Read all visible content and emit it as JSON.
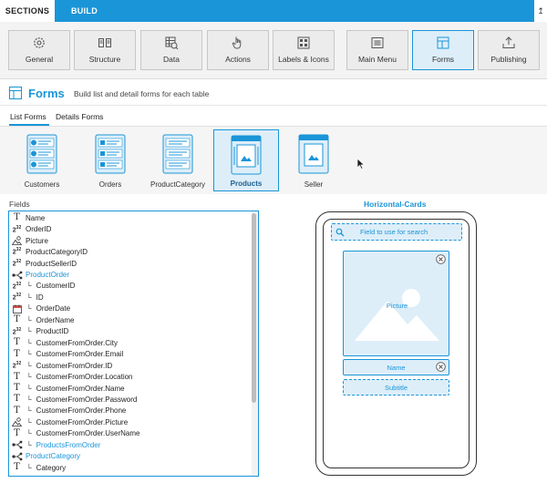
{
  "topbar": {
    "sections_tab": "SECTIONS",
    "build_tab": "BUILD",
    "right_glyph": "↥"
  },
  "section_tiles": [
    {
      "label": "General",
      "icon": "gear-icon"
    },
    {
      "label": "Structure",
      "icon": "structure-icon"
    },
    {
      "label": "Data",
      "icon": "data-icon"
    },
    {
      "label": "Actions",
      "icon": "hand-pointer-icon"
    },
    {
      "label": "Labels & Icons",
      "icon": "labels-icons-icon"
    },
    {
      "label": "Main Menu",
      "icon": "menu-icon"
    },
    {
      "label": "Forms",
      "icon": "forms-icon",
      "active": true
    },
    {
      "label": "Publishing",
      "icon": "publish-icon"
    }
  ],
  "header": {
    "title": "Forms",
    "description": "Build list and detail forms for each table"
  },
  "subtabs": {
    "list_forms": "List Forms",
    "details_forms": "Details Forms",
    "active": "List Forms"
  },
  "tables": [
    {
      "label": "Customers",
      "icon": "list-form-circles-icon"
    },
    {
      "label": "Orders",
      "icon": "list-form-rows-icon"
    },
    {
      "label": "ProductCategory",
      "icon": "list-form-lines-icon"
    },
    {
      "label": "Products",
      "icon": "horizontal-cards-icon",
      "active": true
    },
    {
      "label": "Seller",
      "icon": "single-card-icon"
    }
  ],
  "fields": {
    "label": "Fields",
    "items": [
      {
        "type": "text",
        "name": "Name",
        "indent": false
      },
      {
        "type": "number",
        "name": "OrderID",
        "indent": false
      },
      {
        "type": "picture",
        "name": "Picture",
        "indent": false
      },
      {
        "type": "number",
        "name": "ProductCategoryID",
        "indent": false
      },
      {
        "type": "number",
        "name": "ProductSellerID",
        "indent": false
      },
      {
        "type": "relation",
        "name": "ProductOrder",
        "indent": false
      },
      {
        "type": "number",
        "name": "CustomerID",
        "indent": true
      },
      {
        "type": "number",
        "name": "ID",
        "indent": true
      },
      {
        "type": "date",
        "name": "OrderDate",
        "indent": true
      },
      {
        "type": "text",
        "name": "OrderName",
        "indent": true
      },
      {
        "type": "number",
        "name": "ProductID",
        "indent": true
      },
      {
        "type": "text",
        "name": "CustomerFromOrder.City",
        "indent": true
      },
      {
        "type": "text",
        "name": "CustomerFromOrder.Email",
        "indent": true
      },
      {
        "type": "number",
        "name": "CustomerFromOrder.ID",
        "indent": true
      },
      {
        "type": "text",
        "name": "CustomerFromOrder.Location",
        "indent": true
      },
      {
        "type": "text",
        "name": "CustomerFromOrder.Name",
        "indent": true
      },
      {
        "type": "text",
        "name": "CustomerFromOrder.Password",
        "indent": true
      },
      {
        "type": "text",
        "name": "CustomerFromOrder.Phone",
        "indent": true
      },
      {
        "type": "picture",
        "name": "CustomerFromOrder.Picture",
        "indent": true
      },
      {
        "type": "text",
        "name": "CustomerFromOrder.UserName",
        "indent": true
      },
      {
        "type": "relation",
        "name": "ProductsFromOrder",
        "indent": true
      },
      {
        "type": "relation",
        "name": "ProductCategory",
        "indent": false
      },
      {
        "type": "text",
        "name": "Category",
        "indent": true
      }
    ]
  },
  "preview": {
    "title": "Horizontal-Cards",
    "search_placeholder": "Field to use for search",
    "picture_label": "Picture",
    "name_label": "Name",
    "subtitle_label": "Subtitle"
  },
  "colors": {
    "accent": "#1a95d8",
    "accent_light": "#ddeef9"
  }
}
